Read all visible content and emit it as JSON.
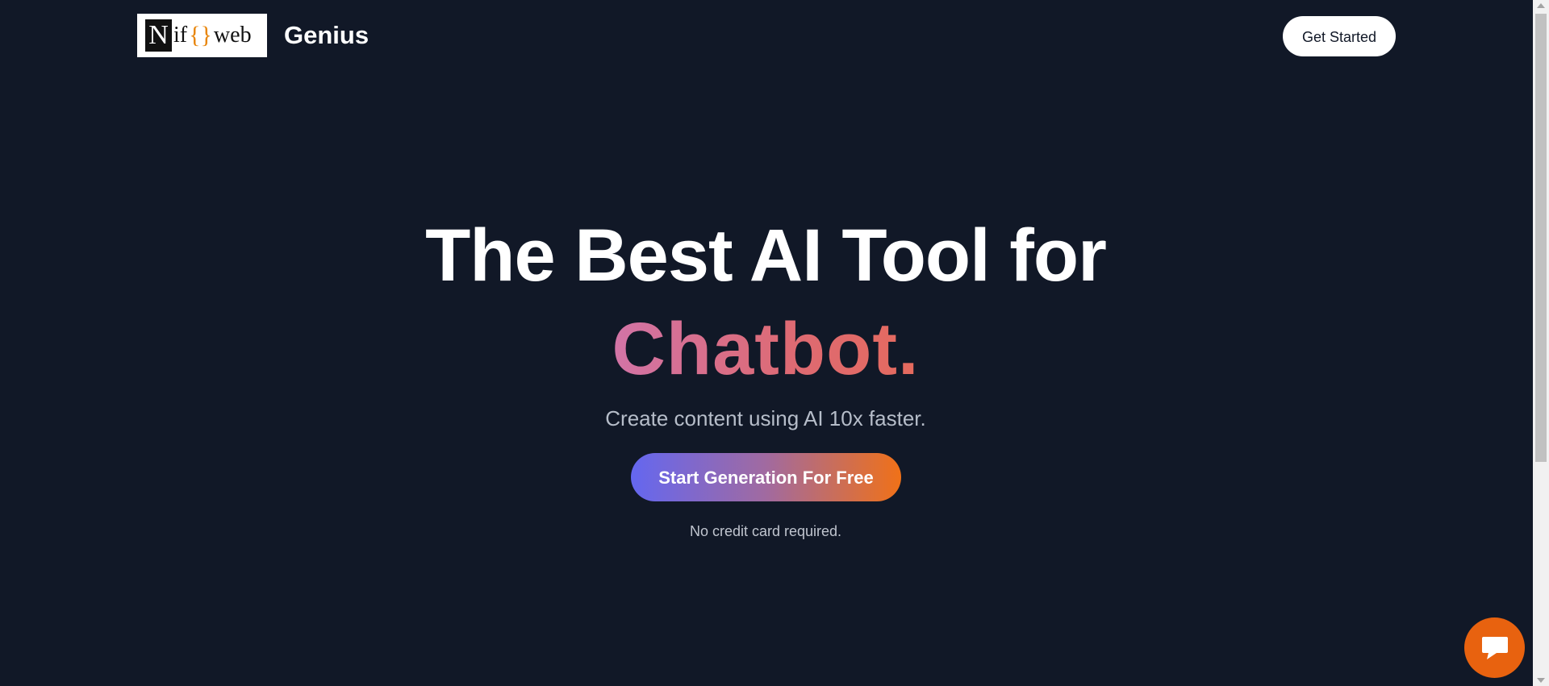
{
  "header": {
    "logo": {
      "letter": "N",
      "text_if": "if",
      "braces": "{}",
      "text_web": "web"
    },
    "brand_name": "Genius",
    "get_started_label": "Get Started"
  },
  "hero": {
    "headline_line1": "The Best AI Tool for",
    "headline_highlight": "Chatbot.",
    "subtitle": "Create content using AI 10x faster.",
    "cta_label": "Start Generation For Free",
    "cta_note": "No credit card required."
  },
  "chat_widget": {
    "icon": "chat-bubble-icon"
  },
  "colors": {
    "background": "#111827",
    "cta_gradient_start": "#6467f0",
    "cta_gradient_end": "#f07118",
    "highlight_gradient_start": "#d274a7",
    "highlight_gradient_end": "#e56a5d",
    "chat_widget": "#e8620f"
  }
}
